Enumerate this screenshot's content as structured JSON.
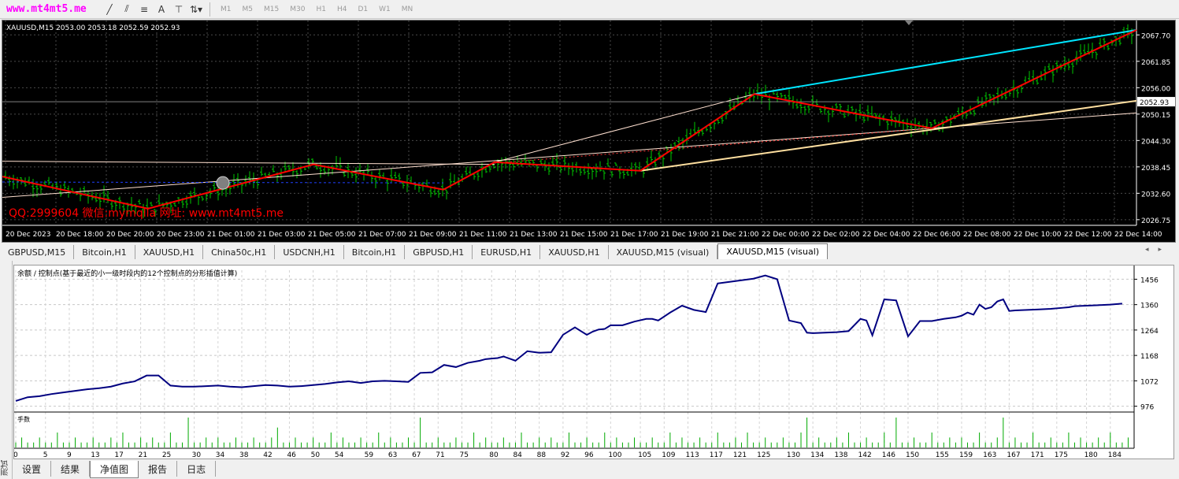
{
  "toolbar": {
    "brand": "www.mt4mt5.me",
    "timeframes": [
      "M1",
      "M5",
      "M15",
      "M30",
      "H1",
      "H4",
      "D1",
      "W1",
      "MN"
    ],
    "text_tool": "A"
  },
  "chart": {
    "header": "XAUUSD,M15  2053.00 2053.18 2052.59 2052.93",
    "watermark": "QQ:2999604 微信:mymqlla 网址: www.mt4mt5.me",
    "current_price": "2052.93",
    "price_ticks": [
      "2067.70",
      "2061.85",
      "2056.00",
      "2050.15",
      "2044.30",
      "2038.45",
      "2032.60",
      "2026.75"
    ],
    "time_ticks": [
      "20 Dec 2023",
      "20 Dec 18:00",
      "20 Dec 20:00",
      "20 Dec 23:00",
      "21 Dec 01:00",
      "21 Dec 03:00",
      "21 Dec 05:00",
      "21 Dec 07:00",
      "21 Dec 09:00",
      "21 Dec 11:00",
      "21 Dec 13:00",
      "21 Dec 15:00",
      "21 Dec 17:00",
      "21 Dec 19:00",
      "21 Dec 21:00",
      "22 Dec 00:00",
      "22 Dec 02:00",
      "22 Dec 04:00",
      "22 Dec 06:00",
      "22 Dec 08:00",
      "22 Dec 10:00",
      "22 Dec 12:00",
      "22 Dec 14:00"
    ],
    "colors": {
      "background": "#000000",
      "candles": "#00c800",
      "zigzag": "#ff0000",
      "upper_channel": "#00e5ff",
      "lower_channel": "#ffe0a0"
    }
  },
  "chart_tabs": [
    "GBPUSD,M15",
    "Bitcoin,H1",
    "XAUUSD,H1",
    "China50c,H1",
    "USDCNH,H1",
    "Bitcoin,H1",
    "GBPUSD,H1",
    "EURUSD,H1",
    "XAUUSD,H1",
    "XAUUSD,M15 (visual)",
    "XAUUSD,M15 (visual)"
  ],
  "active_chart_tab": 10,
  "side_panel_label": "测试",
  "chart_data": [
    {
      "type": "line",
      "title": "余额 / 控制点(基于最近的小一级时段内的12个控制点的分形插值计算)",
      "xlabel": "",
      "ylabel": "",
      "ylim": [
        960,
        1490
      ],
      "y_ticks": [
        "1456",
        "1360",
        "1264",
        "1168",
        "1072",
        "976"
      ],
      "x_ticks": [
        "0",
        "5",
        "9",
        "13",
        "17",
        "21",
        "25",
        "30",
        "34",
        "38",
        "42",
        "46",
        "50",
        "54",
        "59",
        "63",
        "67",
        "71",
        "75",
        "80",
        "84",
        "88",
        "92",
        "96",
        "100",
        "105",
        "109",
        "113",
        "117",
        "121",
        "125",
        "130",
        "134",
        "138",
        "142",
        "146",
        "150",
        "155",
        "159",
        "163",
        "167",
        "171",
        "175",
        "180",
        "184"
      ],
      "series": [
        {
          "x": [
            0,
            2,
            4,
            6,
            8,
            10,
            12,
            14,
            16,
            18,
            20,
            22,
            24,
            26,
            28,
            30,
            32,
            34,
            36,
            38,
            40,
            42,
            44,
            46,
            48,
            50,
            52,
            54,
            56,
            58,
            60,
            62,
            64,
            66,
            68,
            70,
            72,
            74,
            76,
            78,
            79,
            80,
            81,
            82,
            84,
            86,
            88,
            90,
            92,
            94,
            96,
            97,
            98,
            99,
            100,
            102,
            104,
            106,
            107,
            108,
            110,
            112,
            114,
            116,
            118,
            120,
            122,
            124,
            126,
            128,
            130,
            132,
            133,
            134,
            136,
            138,
            140,
            142,
            143,
            144,
            146,
            148,
            150,
            152,
            154,
            156,
            158,
            159,
            160,
            161,
            162,
            163,
            164,
            165,
            166,
            167,
            168,
            170,
            172,
            174,
            176,
            177,
            178,
            180,
            182,
            184,
            185,
            186
          ],
          "values": [
            996,
            1010,
            1014,
            1022,
            1028,
            1034,
            1040,
            1044,
            1050,
            1062,
            1070,
            1092,
            1092,
            1054,
            1050,
            1050,
            1052,
            1054,
            1050,
            1048,
            1052,
            1056,
            1054,
            1050,
            1052,
            1056,
            1060,
            1066,
            1070,
            1064,
            1070,
            1072,
            1070,
            1068,
            1102,
            1104,
            1132,
            1124,
            1140,
            1148,
            1154,
            1156,
            1158,
            1164,
            1148,
            1184,
            1178,
            1180,
            1246,
            1274,
            1246,
            1258,
            1266,
            1268,
            1282,
            1282,
            1296,
            1306,
            1306,
            1300,
            1330,
            1356,
            1340,
            1332,
            1440,
            1446,
            1452,
            1458,
            1470,
            1456,
            1300,
            1290,
            1254,
            1252,
            1254,
            1256,
            1260,
            1306,
            1300,
            1244,
            1380,
            1376,
            1240,
            1298,
            1298,
            1306,
            1312,
            1318,
            1330,
            1322,
            1360,
            1344,
            1350,
            1372,
            1380,
            1336,
            1338,
            1340,
            1342,
            1344,
            1348,
            1350,
            1354,
            1356,
            1358,
            1360,
            1362,
            1364
          ]
        }
      ]
    },
    {
      "type": "bar",
      "title": "手数",
      "x_ticks": [
        "0",
        "5",
        "9",
        "13",
        "17",
        "21",
        "25",
        "30",
        "34",
        "38",
        "42",
        "46",
        "50",
        "54",
        "59",
        "63",
        "67",
        "71",
        "75",
        "80",
        "84",
        "88",
        "92",
        "96",
        "100",
        "105",
        "109",
        "113",
        "117",
        "121",
        "125",
        "130",
        "134",
        "138",
        "142",
        "146",
        "150",
        "155",
        "159",
        "163",
        "167",
        "171",
        "175",
        "180",
        "184"
      ],
      "values": [
        1,
        2,
        1,
        1,
        2,
        1,
        1,
        3,
        1,
        1,
        2,
        1,
        1,
        2,
        1,
        1,
        2,
        1,
        3,
        1,
        1,
        2,
        1,
        2,
        1,
        1,
        3,
        1,
        1,
        6,
        1,
        1,
        2,
        1,
        2,
        1,
        1,
        2,
        1,
        1,
        2,
        1,
        1,
        2,
        4,
        1,
        1,
        2,
        1,
        1,
        2,
        1,
        1,
        3,
        1,
        2,
        1,
        1,
        2,
        1,
        1,
        3,
        1,
        2,
        1,
        1,
        2,
        1,
        6,
        1,
        1,
        2,
        1,
        1,
        2,
        1,
        1,
        3,
        1,
        2,
        1,
        1,
        2,
        1,
        1,
        3,
        1,
        1,
        2,
        1,
        2,
        1,
        1,
        3,
        1,
        1,
        2,
        1,
        1,
        3,
        1,
        2,
        1,
        1,
        2,
        1,
        1,
        2,
        1,
        1,
        3,
        1,
        2,
        1,
        1,
        2,
        1,
        1,
        3,
        1,
        1,
        2,
        1,
        3,
        1,
        1,
        2,
        1,
        1,
        2,
        1,
        1,
        3,
        6,
        1,
        2,
        1,
        1,
        2,
        1,
        3,
        1,
        1,
        2,
        1,
        1,
        3,
        1,
        6,
        1,
        1,
        2,
        1,
        1,
        3,
        1,
        1,
        2,
        1,
        2,
        1,
        1,
        3,
        1,
        1,
        2,
        6,
        1,
        2,
        1,
        1,
        3,
        1,
        1,
        2,
        1,
        1,
        3,
        1,
        2,
        1,
        1,
        2,
        1,
        3,
        1,
        1,
        2
      ]
    }
  ],
  "bottom_tabs": [
    "设置",
    "结果",
    "净值图",
    "报告",
    "日志"
  ],
  "active_bottom_tab": 2
}
